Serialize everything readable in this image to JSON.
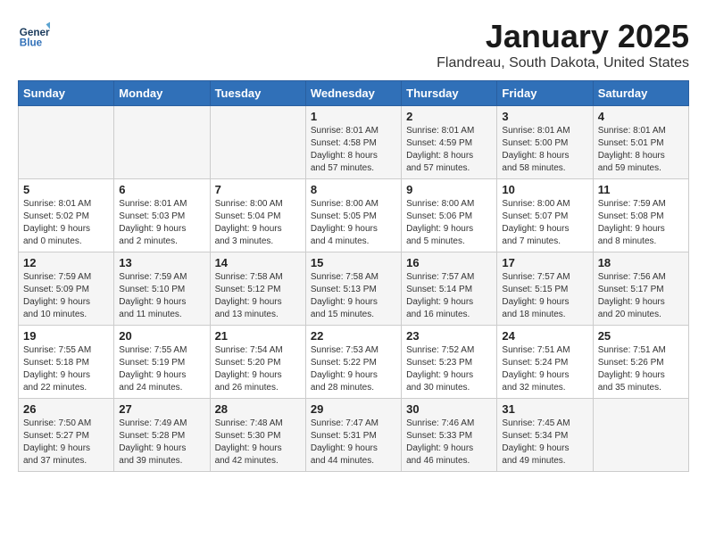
{
  "header": {
    "logo_line1": "General",
    "logo_line2": "Blue",
    "title": "January 2025",
    "subtitle": "Flandreau, South Dakota, United States"
  },
  "weekdays": [
    "Sunday",
    "Monday",
    "Tuesday",
    "Wednesday",
    "Thursday",
    "Friday",
    "Saturday"
  ],
  "rows": [
    [
      {
        "day": "",
        "info": ""
      },
      {
        "day": "",
        "info": ""
      },
      {
        "day": "",
        "info": ""
      },
      {
        "day": "1",
        "info": "Sunrise: 8:01 AM\nSunset: 4:58 PM\nDaylight: 8 hours\nand 57 minutes."
      },
      {
        "day": "2",
        "info": "Sunrise: 8:01 AM\nSunset: 4:59 PM\nDaylight: 8 hours\nand 57 minutes."
      },
      {
        "day": "3",
        "info": "Sunrise: 8:01 AM\nSunset: 5:00 PM\nDaylight: 8 hours\nand 58 minutes."
      },
      {
        "day": "4",
        "info": "Sunrise: 8:01 AM\nSunset: 5:01 PM\nDaylight: 8 hours\nand 59 minutes."
      }
    ],
    [
      {
        "day": "5",
        "info": "Sunrise: 8:01 AM\nSunset: 5:02 PM\nDaylight: 9 hours\nand 0 minutes."
      },
      {
        "day": "6",
        "info": "Sunrise: 8:01 AM\nSunset: 5:03 PM\nDaylight: 9 hours\nand 2 minutes."
      },
      {
        "day": "7",
        "info": "Sunrise: 8:00 AM\nSunset: 5:04 PM\nDaylight: 9 hours\nand 3 minutes."
      },
      {
        "day": "8",
        "info": "Sunrise: 8:00 AM\nSunset: 5:05 PM\nDaylight: 9 hours\nand 4 minutes."
      },
      {
        "day": "9",
        "info": "Sunrise: 8:00 AM\nSunset: 5:06 PM\nDaylight: 9 hours\nand 5 minutes."
      },
      {
        "day": "10",
        "info": "Sunrise: 8:00 AM\nSunset: 5:07 PM\nDaylight: 9 hours\nand 7 minutes."
      },
      {
        "day": "11",
        "info": "Sunrise: 7:59 AM\nSunset: 5:08 PM\nDaylight: 9 hours\nand 8 minutes."
      }
    ],
    [
      {
        "day": "12",
        "info": "Sunrise: 7:59 AM\nSunset: 5:09 PM\nDaylight: 9 hours\nand 10 minutes."
      },
      {
        "day": "13",
        "info": "Sunrise: 7:59 AM\nSunset: 5:10 PM\nDaylight: 9 hours\nand 11 minutes."
      },
      {
        "day": "14",
        "info": "Sunrise: 7:58 AM\nSunset: 5:12 PM\nDaylight: 9 hours\nand 13 minutes."
      },
      {
        "day": "15",
        "info": "Sunrise: 7:58 AM\nSunset: 5:13 PM\nDaylight: 9 hours\nand 15 minutes."
      },
      {
        "day": "16",
        "info": "Sunrise: 7:57 AM\nSunset: 5:14 PM\nDaylight: 9 hours\nand 16 minutes."
      },
      {
        "day": "17",
        "info": "Sunrise: 7:57 AM\nSunset: 5:15 PM\nDaylight: 9 hours\nand 18 minutes."
      },
      {
        "day": "18",
        "info": "Sunrise: 7:56 AM\nSunset: 5:17 PM\nDaylight: 9 hours\nand 20 minutes."
      }
    ],
    [
      {
        "day": "19",
        "info": "Sunrise: 7:55 AM\nSunset: 5:18 PM\nDaylight: 9 hours\nand 22 minutes."
      },
      {
        "day": "20",
        "info": "Sunrise: 7:55 AM\nSunset: 5:19 PM\nDaylight: 9 hours\nand 24 minutes."
      },
      {
        "day": "21",
        "info": "Sunrise: 7:54 AM\nSunset: 5:20 PM\nDaylight: 9 hours\nand 26 minutes."
      },
      {
        "day": "22",
        "info": "Sunrise: 7:53 AM\nSunset: 5:22 PM\nDaylight: 9 hours\nand 28 minutes."
      },
      {
        "day": "23",
        "info": "Sunrise: 7:52 AM\nSunset: 5:23 PM\nDaylight: 9 hours\nand 30 minutes."
      },
      {
        "day": "24",
        "info": "Sunrise: 7:51 AM\nSunset: 5:24 PM\nDaylight: 9 hours\nand 32 minutes."
      },
      {
        "day": "25",
        "info": "Sunrise: 7:51 AM\nSunset: 5:26 PM\nDaylight: 9 hours\nand 35 minutes."
      }
    ],
    [
      {
        "day": "26",
        "info": "Sunrise: 7:50 AM\nSunset: 5:27 PM\nDaylight: 9 hours\nand 37 minutes."
      },
      {
        "day": "27",
        "info": "Sunrise: 7:49 AM\nSunset: 5:28 PM\nDaylight: 9 hours\nand 39 minutes."
      },
      {
        "day": "28",
        "info": "Sunrise: 7:48 AM\nSunset: 5:30 PM\nDaylight: 9 hours\nand 42 minutes."
      },
      {
        "day": "29",
        "info": "Sunrise: 7:47 AM\nSunset: 5:31 PM\nDaylight: 9 hours\nand 44 minutes."
      },
      {
        "day": "30",
        "info": "Sunrise: 7:46 AM\nSunset: 5:33 PM\nDaylight: 9 hours\nand 46 minutes."
      },
      {
        "day": "31",
        "info": "Sunrise: 7:45 AM\nSunset: 5:34 PM\nDaylight: 9 hours\nand 49 minutes."
      },
      {
        "day": "",
        "info": ""
      }
    ]
  ]
}
